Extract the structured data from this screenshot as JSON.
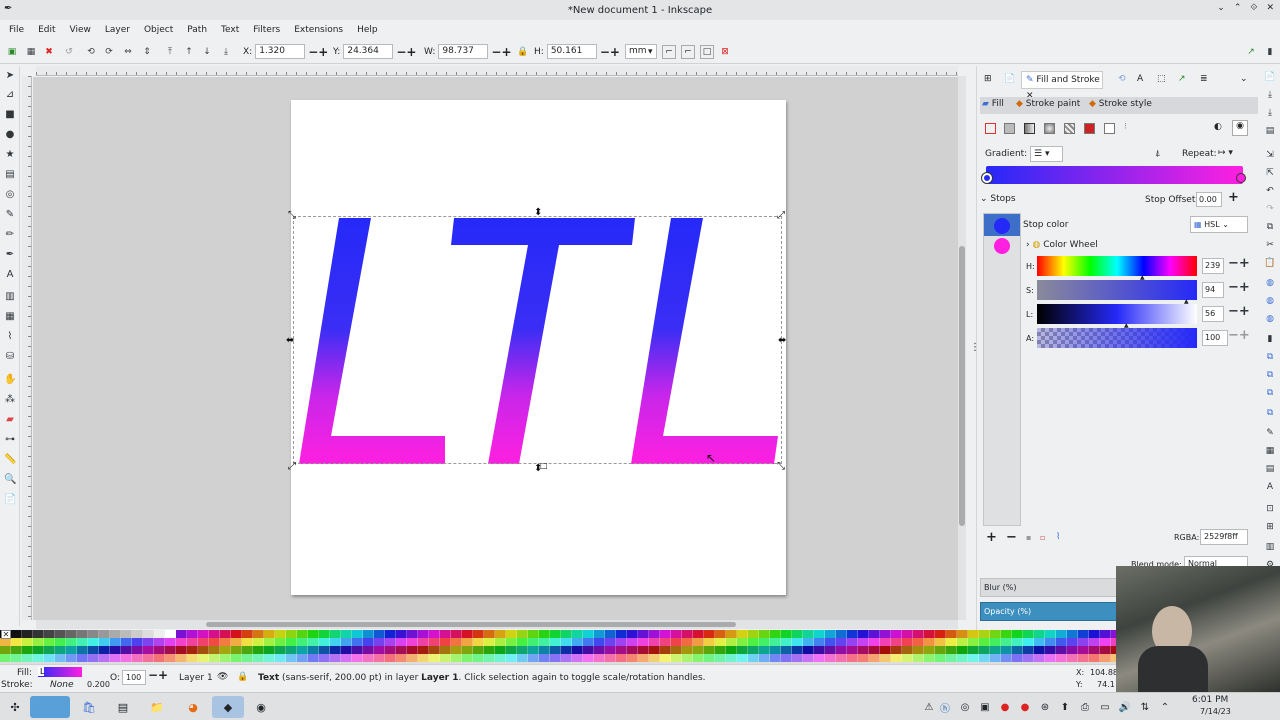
{
  "window": {
    "title": "*New document 1 - Inkscape",
    "controls": [
      "⌄",
      "⌃",
      "⟐",
      "✕"
    ]
  },
  "menu": [
    "File",
    "Edit",
    "View",
    "Layer",
    "Object",
    "Path",
    "Text",
    "Filters",
    "Extensions",
    "Help"
  ],
  "toolctrl": {
    "x_label": "X:",
    "x": "1.320",
    "y_label": "Y:",
    "y": "24.364",
    "w_label": "W:",
    "w": "98.737",
    "h_label": "H:",
    "h": "50.161",
    "unit": "mm"
  },
  "canvas": {
    "text": "LTL",
    "gradient_start": "#2529f8",
    "gradient_end": "#ff20e0"
  },
  "panel": {
    "tab_title": "Fill and Stroke",
    "tabs": [
      "Fill",
      "Stroke paint",
      "Stroke style"
    ],
    "gradient_label": "Gradient:",
    "repeat_label": "Repeat:",
    "stops_label": "Stops",
    "stop_offset_label": "Stop Offset:",
    "stop_offset": "0.00",
    "stop_color_label": "Stop color",
    "color_mode": "HSL",
    "color_wheel_label": "Color Wheel",
    "sliders": [
      {
        "label": "H:",
        "value": "239"
      },
      {
        "label": "S:",
        "value": "94"
      },
      {
        "label": "L:",
        "value": "56"
      },
      {
        "label": "A:",
        "value": "100"
      }
    ],
    "rgba_label": "RGBA:",
    "rgba": "2529f8ff",
    "blend_label": "Blend mode:",
    "blend": "Normal",
    "blur_label": "Blur (%)",
    "opacity_label": "Opacity (%)"
  },
  "status": {
    "fill_label": "Fill:",
    "fill_value": "L",
    "stroke_label": "Stroke:",
    "stroke_value": "None",
    "stroke_width": "0.200",
    "opacity_label": "O:",
    "opacity": "100",
    "layer": "Layer 1",
    "msg_obj": "Text",
    "msg_rest": " (sans-serif, 200.00 pt) in layer ",
    "msg_layer": "Layer 1",
    "msg_tail": ". Click selection again to toggle scale/rotation handles.",
    "x_label": "X:",
    "x": "104.88",
    "y_label": "Y:",
    "y": "74.1"
  },
  "taskbar": {
    "time": "6:01 PM",
    "date": "7/14/23"
  }
}
